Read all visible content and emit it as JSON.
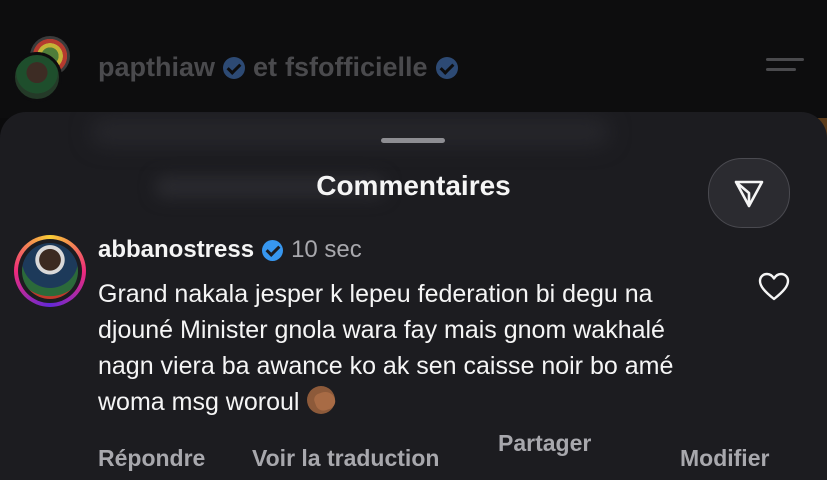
{
  "header": {
    "user1": "papthiaw",
    "connector": "et",
    "user2": "fsfofficielle"
  },
  "sheet": {
    "title": "Commentaires",
    "share_icon": "send-icon"
  },
  "comment": {
    "username": "abbanostress",
    "time": "10 sec",
    "text": "Grand nakala jesper k lepeu federation bi degu na djouné Minister gnola wara fay mais gnom wakhalé nagn viera ba awance ko ak sen caisse noir bo amé woma msg woroul",
    "emoji": "face-palm-emoji",
    "like_icon": "heart-icon"
  },
  "actions": {
    "reply": "Répondre",
    "translate": "Voir la traduction",
    "share": "Partager",
    "edit": "Modifier"
  },
  "colors": {
    "sheet_bg": "#1c1c20",
    "verified": "#3797f0",
    "secondary_text": "#a8a8ad"
  }
}
